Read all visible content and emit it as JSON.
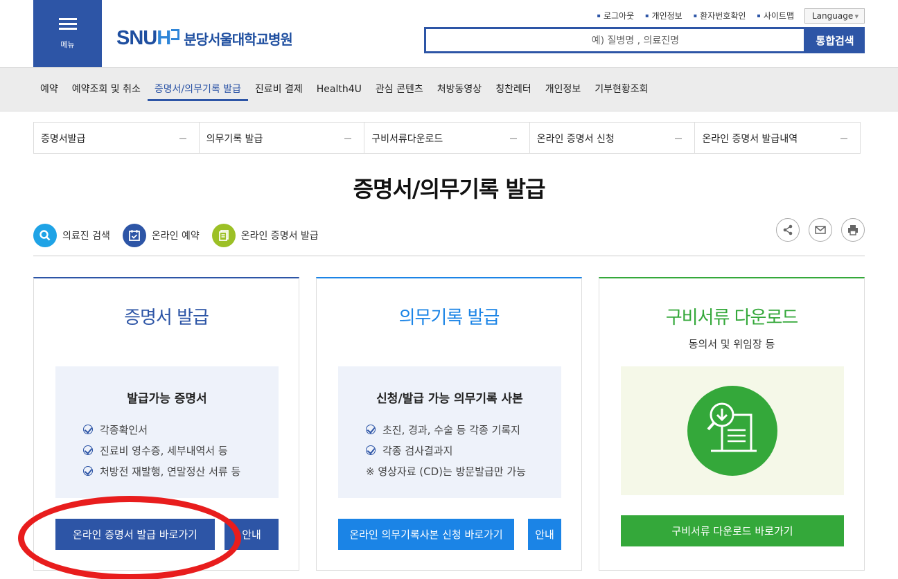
{
  "header": {
    "menu_label": "메뉴",
    "logo_text_a": "SNU",
    "logo_text_b": "H",
    "logo_korean": "분당서울대학교병원",
    "util_links": [
      "로그아웃",
      "개인정보",
      "환자번호확인",
      "사이트맵"
    ],
    "language_label": "Language",
    "search_placeholder": "예) 질병명 , 의료진명",
    "search_button": "통합검색"
  },
  "gnb": [
    "예약",
    "예약조회 및 취소",
    "증명서/의무기록 발급",
    "진료비 결제",
    "Health4U",
    "관심 콘텐츠",
    "처방동영상",
    "칭찬레터",
    "개인정보",
    "기부현황조회"
  ],
  "gnb_active_index": 2,
  "subtabs": [
    "증명서발급",
    "의무기록 발급",
    "구비서류다운로드",
    "온라인 증명서 신청",
    "온라인 증명서 발급내역"
  ],
  "page_title": "증명서/의무기록 발급",
  "quick_links": [
    {
      "label": "의료진 검색",
      "icon": "search-icon",
      "color": "#1fa3e6"
    },
    {
      "label": "온라인 예약",
      "icon": "calendar-icon",
      "color": "#2d55a6"
    },
    {
      "label": "온라인 증명서 발급",
      "icon": "document-icon",
      "color": "#9cc026"
    }
  ],
  "cards": [
    {
      "title": "증명서 발급",
      "color": "#2d55a6",
      "box_title": "발급가능 증명서",
      "items": [
        "각종확인서",
        "진료비 영수증, 세부내역서 등",
        "처방전 재발행, 연말정산 서류 등"
      ],
      "primary_button": "온라인 증명서 발급 바로가기",
      "secondary_button": "안내"
    },
    {
      "title": "의무기록 발급",
      "color": "#1b84e6",
      "box_title": "신청/발급 가능 의무기록 사본",
      "items": [
        "초진, 경과, 수술 등 각종 기록지",
        "각종 검사결과지"
      ],
      "note": "※ 영상자료 (CD)는 방문발급만 가능",
      "primary_button": "온라인 의무기록사본 신청 바로가기",
      "secondary_button": "안내"
    },
    {
      "title": "구비서류 다운로드",
      "color": "#34a83a",
      "subtitle": "동의서 및 위임장 등",
      "primary_button": "구비서류 다운로드 바로가기"
    }
  ]
}
